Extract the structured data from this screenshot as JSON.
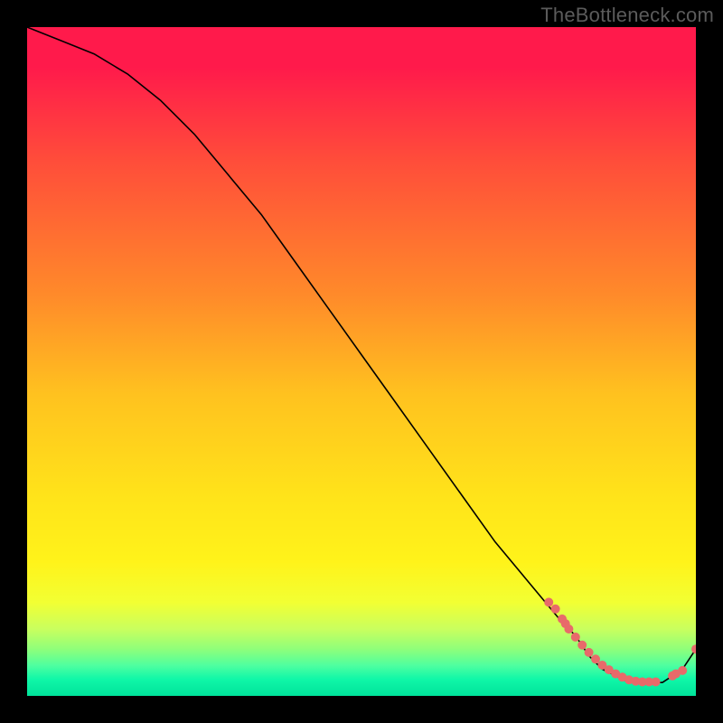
{
  "watermark": "TheBottleneck.com",
  "chart_data": {
    "type": "line",
    "title": "",
    "xlabel": "",
    "ylabel": "",
    "xlim": [
      0,
      100
    ],
    "ylim": [
      0,
      100
    ],
    "series": [
      {
        "name": "curve",
        "x": [
          0,
          5,
          10,
          15,
          20,
          25,
          30,
          35,
          40,
          45,
          50,
          55,
          60,
          65,
          70,
          75,
          80,
          82,
          84,
          86,
          88,
          90,
          92,
          95,
          98,
          100
        ],
        "y": [
          100,
          98,
          96,
          93,
          89,
          84,
          78,
          72,
          65,
          58,
          51,
          44,
          37,
          30,
          23,
          17,
          11,
          9,
          6,
          4,
          3,
          2,
          2,
          2,
          4,
          7
        ]
      }
    ],
    "markers": [
      {
        "name": "cluster-mid",
        "x": [
          78,
          79,
          80,
          80.5,
          81,
          82,
          83,
          84,
          85,
          86,
          87,
          88,
          89,
          90,
          91,
          92,
          93,
          94
        ],
        "y": [
          14,
          13,
          11.5,
          10.8,
          10,
          8.8,
          7.6,
          6.5,
          5.5,
          4.6,
          3.9,
          3.3,
          2.8,
          2.4,
          2.2,
          2.1,
          2.1,
          2.1
        ],
        "r": 5
      },
      {
        "name": "cluster-right",
        "x": [
          96.5,
          97,
          98,
          100
        ],
        "y": [
          3.0,
          3.3,
          3.8,
          7.0
        ],
        "r": 5
      }
    ],
    "gradient_stops": [
      {
        "offset": 0.0,
        "color": "#ff1a4b"
      },
      {
        "offset": 0.06,
        "color": "#ff1a4b"
      },
      {
        "offset": 0.2,
        "color": "#ff4d3a"
      },
      {
        "offset": 0.4,
        "color": "#ff8a2a"
      },
      {
        "offset": 0.55,
        "color": "#ffc21f"
      },
      {
        "offset": 0.7,
        "color": "#ffe31a"
      },
      {
        "offset": 0.8,
        "color": "#fff31a"
      },
      {
        "offset": 0.86,
        "color": "#f2ff33"
      },
      {
        "offset": 0.9,
        "color": "#c9ff5e"
      },
      {
        "offset": 0.93,
        "color": "#8fff7a"
      },
      {
        "offset": 0.955,
        "color": "#4dffa0"
      },
      {
        "offset": 0.975,
        "color": "#10f7a8"
      },
      {
        "offset": 1.0,
        "color": "#00e39a"
      }
    ],
    "marker_color": "#e86a6a",
    "curve_color": "#000000"
  }
}
